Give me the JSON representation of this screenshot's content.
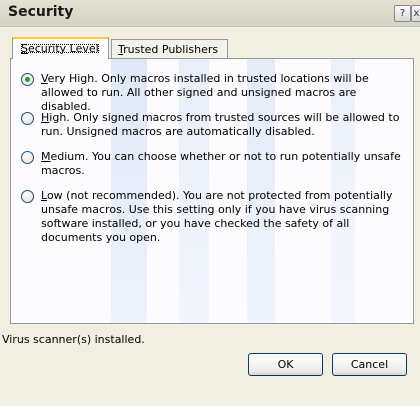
{
  "window": {
    "title": "Security",
    "help_label": "?",
    "close_label": "x"
  },
  "tabs": [
    {
      "label_key": "S",
      "label_rest": "ecurity Level",
      "active": true
    },
    {
      "label_key": "T",
      "label_rest": "rusted Publishers",
      "active": false
    }
  ],
  "options": [
    {
      "key": "V",
      "rest": "ery High. Only macros installed in trusted locations will be allowed to run. All other signed and unsigned macros are disabled.",
      "checked": true
    },
    {
      "key": "H",
      "rest": "igh. Only signed macros from trusted sources will be allowed to run. Unsigned macros are automatically disabled.",
      "checked": false
    },
    {
      "key": "M",
      "rest": "edium. You can choose whether or not to run potentially unsafe macros.",
      "checked": false
    },
    {
      "key": "L",
      "rest": "ow (not recommended). You are not protected from potentially unsafe macros. Use this setting only if you have virus scanning software installed, or you have checked the safety of all documents you open.",
      "checked": false
    }
  ],
  "status": {
    "text": "Virus scanner(s) installed."
  },
  "buttons": {
    "ok": "OK",
    "cancel": "Cancel"
  }
}
